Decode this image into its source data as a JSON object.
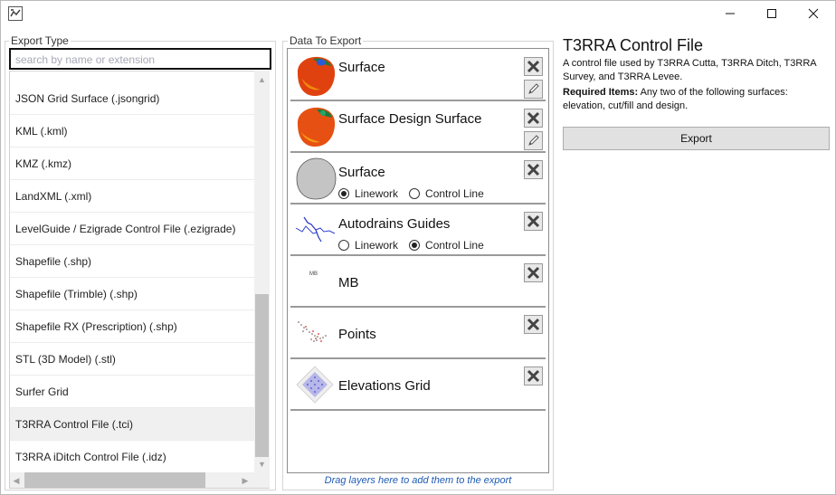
{
  "window": {
    "icons": {
      "app": "app-icon",
      "minimize": "minimize-icon",
      "maximize": "maximize-icon",
      "close": "close-icon"
    }
  },
  "export_type": {
    "group_title": "Export Type",
    "search_placeholder": "search by name or extension",
    "items": [
      {
        "label": "JSON Grid Surface (.jsongrid)",
        "selected": false
      },
      {
        "label": "KML (.kml)",
        "selected": false
      },
      {
        "label": "KMZ (.kmz)",
        "selected": false
      },
      {
        "label": "LandXML (.xml)",
        "selected": false
      },
      {
        "label": "LevelGuide / Ezigrade Control File (.ezigrade)",
        "selected": false
      },
      {
        "label": "Shapefile (.shp)",
        "selected": false
      },
      {
        "label": "Shapefile (Trimble) (.shp)",
        "selected": false
      },
      {
        "label": "Shapefile RX (Prescription) (.shp)",
        "selected": false
      },
      {
        "label": "STL (3D Model) (.stl)",
        "selected": false
      },
      {
        "label": "Surfer Grid",
        "selected": false
      },
      {
        "label": "T3RRA Control File (.tci)",
        "selected": true
      },
      {
        "label": "T3RRA iDitch Control File (.idz)",
        "selected": false
      }
    ]
  },
  "data_to_export": {
    "group_title": "Data To Export",
    "layers": [
      {
        "name": "Surface",
        "thumbnail": "surface-thumbnail",
        "has_edit": true,
        "radio": null
      },
      {
        "name": "Surface Design Surface",
        "thumbnail": "design-surface-thumbnail",
        "has_edit": true,
        "radio": null
      },
      {
        "name": "Surface",
        "thumbnail": "boundary-thumbnail",
        "has_edit": false,
        "radio": {
          "options": [
            "Linework",
            "Control Line"
          ],
          "selected": "Linework"
        }
      },
      {
        "name": "Autodrains Guides",
        "thumbnail": "guides-thumbnail",
        "has_edit": false,
        "radio": {
          "options": [
            "Linework",
            "Control Line"
          ],
          "selected": "Control Line"
        }
      },
      {
        "name": "MB",
        "thumbnail": "mb-thumbnail",
        "thumb_text": "MB",
        "has_edit": false,
        "radio": null
      },
      {
        "name": "Points",
        "thumbnail": "points-thumbnail",
        "has_edit": false,
        "radio": null
      },
      {
        "name": "Elevations Grid",
        "thumbnail": "grid-thumbnail",
        "has_edit": false,
        "radio": null
      }
    ],
    "drag_hint": "Drag layers here to add them to the export"
  },
  "details": {
    "title": "T3RRA Control File",
    "description": "A control file used by T3RRA Cutta, T3RRA Ditch, T3RRA Survey, and T3RRA Levee.",
    "required_label": "Required Items:",
    "required_text": " Any two of the following surfaces: elevation, cut/fill and design.",
    "export_button": "Export"
  },
  "colors": {
    "accent_link": "#1e5ab5",
    "selected_row": "#f0f0f0",
    "surface_hot": "#e0420f",
    "surface_warm": "#f08a12",
    "surface_cool": "#1e7a3a"
  }
}
